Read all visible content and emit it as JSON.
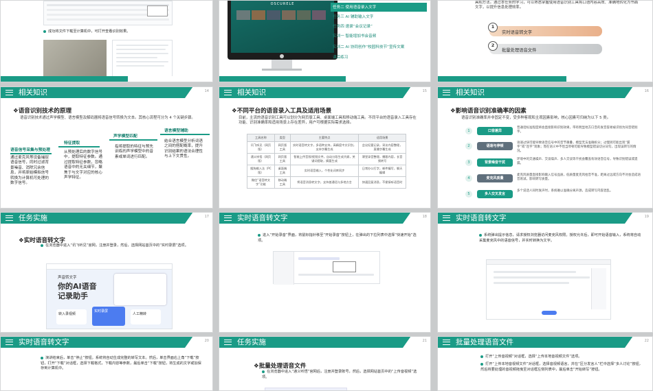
{
  "slides": {
    "s1": {
      "step_text": "成功将文件下载至计算机中，可打开查看识别效果。"
    },
    "s2": {
      "brand": "OSCURELE",
      "menu": [
        "任务二 使用语音录入文字",
        "任务三 AI 辅助输入文字",
        "任务四 速录“会议记录”",
        "实训一 智能增加书会音频",
        "实训二 AI 协同创作“校园科技节”宣传文案",
        "课后练习"
      ]
    },
    "s3": {
      "intro": "具和方法。通过本任务的学习，可以熟悉掌握使用语音识别工具将口语内容高效、准确地转化为书面文字，以提升信息处理效率。",
      "items": [
        {
          "num": "1",
          "label": "实时语音转文字"
        },
        {
          "num": "2",
          "label": "批量处理语音文件"
        }
      ]
    },
    "s4": {
      "header": "相关知识",
      "page": "14",
      "title": "❖语音识别技术的原理",
      "intro": "语音识别技术通过声学模型、语言模型及解码器将语音信号转换为文本。其核心流程可分为 4 个关键步骤。",
      "steps": [
        {
          "title": "语音信号采集与预处理",
          "text": "通过麦克风等设备捕捉语音信号，同时过滤背景噪音、消除冗余信息，并将原始模拟信号转换为计算机可处理的数字信号。"
        },
        {
          "title": "特征提取",
          "text": "从预处理后的数字信号中，提取特征参数。通过提取特征参数，忽略语音中的无关细节，聚焦于与文字对应的核心声学特征。"
        },
        {
          "title": "声学模型匹配",
          "text": "指将提取的特征与预先训练的声学模型中的音素或单词进行匹配。"
        },
        {
          "title": "语言模型辅助",
          "text": "结合语言模型分析词语之间的搭配概率，提升识别结果的语法合理性与上下文贯性。"
        }
      ]
    },
    "s5": {
      "header": "相关知识",
      "page": "15",
      "title": "❖不同平台的语音录入工具及适用场景",
      "intro": "目前，主流的语音识别工具可以划分为网页版工具、桌面端工具和移动端工具。不同平台的语音录入工具存在功能、识别准确率和适用场景上存在差异，用户可根据实际需求选择。",
      "columns": [
        "工具名称",
        "类型",
        "主要特点",
        "适用场景"
      ],
      "rows": [
        [
          "讯飞听见（网页版）",
          "网页版工具",
          "实时语音转文字，多语种支持，高精度中文识别，支持字幕生成",
          "会议纪要记录，采访内容整理，直播字幕生成"
        ],
        [
          "通义听悟（网页版）",
          "网页版工具",
          "智能上传音频/视频文件，自动分段生成大纲，关键词提取，摘要生成",
          "课堂录音整理，播客内容，长音频转写"
        ],
        [
          "搜狗输入法（PC 版）",
          "桌面端工具",
          "实时语音输入，个性化词库同步",
          "日常办公打字，邮件编写，聊天编辑"
        ],
        [
          "微信“语音转文字”功能",
          "移动端工具",
          "将语音消息转文字，支持普通话与多地方言",
          "快速回复消息，不便接听语音时"
        ]
      ]
    },
    "s6": {
      "header": "相关知识",
      "page": "16",
      "title": "❖影响语音识别准确率的因素",
      "intro": "语音识别准确率并非固定不变，受多种客观和主观因素影响，核心因素可归纳为以下 5 类。",
      "factors": [
        {
          "num": "1",
          "label": "口音差异",
          "color": "#1a9b86",
          "desc": "普通话标准程度将会直接影响识别效果，带有明显地方口音的发音容易被识别为同音错别字。"
        },
        {
          "num": "2",
          "label": "语速与停顿",
          "color": "#5f6f7c",
          "desc": "语速过快可能导致语音信号中的音节重叠，模型无法准确拆分；过慢则可能出现“漏字”或“连字”现象；而在语义中不恰当停顿可能导致模型错误切分词句，出现误转写的情况。"
        },
        {
          "num": "3",
          "label": "背景噪音干扰",
          "color": "#1a9b86",
          "desc": "环境中的交通噪声、交谈噪声、多人交谈等干扰会覆盖有效语音信号，导致识别错误或遗漏。"
        },
        {
          "num": "4",
          "label": "麦克风质量",
          "color": "#5f6f7c",
          "desc": "麦克风质量直接影响输入信号品质，低质量麦克风拾音不准，距离过远或方向不对会造成语音衰减，影响转写质量。"
        },
        {
          "num": "5",
          "label": "多人交叉发言",
          "color": "#1a9b86",
          "desc": "多个说话人同时发声时，系统难以准确分离声源，造成转写内容混乱。"
        }
      ]
    },
    "s7": {
      "header": "任务实施",
      "page": "17",
      "title": "❖实时语音转文字",
      "step": "在浏览器中进入“讯飞听见”官网，注册并登录，然后，选择网站首页中的“实时录屏”选项。",
      "brand": "声音转文字",
      "hero1": "你的AI语音",
      "hero2": "记录助手",
      "tiles": [
        "转入录视频",
        "实时录屏",
        "人工精转"
      ]
    },
    "s8": {
      "header": "实时语音转文字",
      "page": "18",
      "step": "进入“开始录音”界面，将鼠标指针移至“开始录音”按钮上，在弹出的下拉列表中选择“快速开始”选项。"
    },
    "s9": {
      "header": "实时语音转文字",
      "page": "19",
      "step": "系统弹出提示信息，请求授权浏览器访问麦克风权限。授权允许后，即可开始语音输入，系统将自动采集麦克风中的语音信号，并实时转换为文字。"
    },
    "s10": {
      "header": "实时语音转文字",
      "page": "20",
      "step": "演讲结束后，单击“停止”按钮。系统将自动生成完整的转写文本。然后，单击界面右上角“下载”按钮，打开“下载”对话框，选择下载格式，下载内容等参数，最后单击“下载”按钮，将生成的文字或加保存到计算机中。"
    },
    "s11": {
      "header": "任务实施",
      "page": "21",
      "title": "❖批量处理语音文件",
      "step": "在浏览器中进入“通义听悟”官网后，注册并登录账号，然后，选择网站首页中的“上传音视频”选项。"
    },
    "s12": {
      "header": "批量处理语音文件",
      "page": "22",
      "steps": [
        "打开“上传音视频”对话框，选择“上传本地音视频文件”选项。",
        "打开“上传本地音视频文件”对话框，选择音视频语言，并在“区分发言人”栏中选择“多人讨论”按钮，然后将要处理的音视频拖曳至对话框左侧列表中，最后单击“开始转写”按钮。"
      ]
    }
  }
}
